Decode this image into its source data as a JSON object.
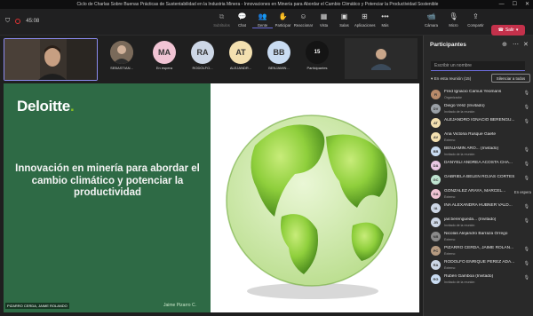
{
  "window": {
    "title": "Ciclo de Charlas Sobre Buenas Prácticas de Sustentabilidad en la Industria Minera - Innovaciones en Minería para Abordar el Cambio Climático y Potenciar la Productividad Sostenible"
  },
  "meeting": {
    "timer": "45:08"
  },
  "toolbar": {
    "items": [
      {
        "label": "Subtítulos",
        "icon": "captions-icon"
      },
      {
        "label": "Chat",
        "icon": "chat-icon"
      },
      {
        "label": "Gente",
        "icon": "people-icon"
      },
      {
        "label": "Participar",
        "icon": "raise-hand-icon"
      },
      {
        "label": "Reaccionar",
        "icon": "react-icon"
      },
      {
        "label": "Vista",
        "icon": "view-icon"
      },
      {
        "label": "Salas",
        "icon": "rooms-icon"
      },
      {
        "label": "Aplicaciones",
        "icon": "apps-icon"
      },
      {
        "label": "Más",
        "icon": "more-icon"
      }
    ],
    "camera": "Cámara",
    "mic": "Micro",
    "share": "Compartir",
    "leave": "Salir"
  },
  "strip": {
    "tiles": [
      {
        "initials": "",
        "name": "SEBASTIAN...",
        "color": "#6b5a4a"
      },
      {
        "initials": "MA",
        "name": "En espera",
        "color": "#f1c4d4"
      },
      {
        "initials": "RA",
        "name": "RODOLFO...",
        "color": "#cdd7e6"
      },
      {
        "initials": "AT",
        "name": "ALEJANDR...",
        "color": "#f3e0b0"
      },
      {
        "initials": "BB",
        "name": "BENJAMIN...",
        "color": "#c9dcf2"
      },
      {
        "initials": "15",
        "name": "Participantes",
        "color": "#141414"
      }
    ]
  },
  "slide": {
    "logo": "Deloitte",
    "logo_dot": ".",
    "title": "Innovación en minería para abordar el cambio climático y potenciar la productividad",
    "presenter": "Jaime Pizarro C.",
    "caption": "PIZARRO CERDA, JAIME ROLANDO"
  },
  "participants": {
    "title": "Participantes",
    "search_placeholder": "Escribir un nombre",
    "section": "En esta reunión (15)",
    "silence_all": "Silenciar a todos",
    "list": [
      {
        "initials": "FI",
        "name": "Fred Ignacio Camus Yeomans",
        "sub": "Organizador",
        "color": "#b88a6a",
        "status": "mic"
      },
      {
        "initials": "DV",
        "name": "Diego Véliz (Invitado)",
        "sub": "Invitado de la reunión",
        "color": "#9aa0a6",
        "status": "mic"
      },
      {
        "initials": "AT",
        "name": "ALEJANDRO IGNACIO BERENGU...",
        "sub": "",
        "color": "#f3e0b0",
        "status": "mic"
      },
      {
        "initials": "AV",
        "name": "Ana Victoria Rusque Gaete",
        "sub": "Externo",
        "color": "#f3e0b0",
        "status": ""
      },
      {
        "initials": "BB",
        "name": "BENJAMIN ARO... (Invitado)",
        "sub": "Invitado de la reunión",
        "color": "#c9dcf2",
        "status": "mic"
      },
      {
        "initials": "DA",
        "name": "DANYELI ANDREA ACOSTA CHA...",
        "sub": "",
        "color": "#e9c7e3",
        "status": "mic"
      },
      {
        "initials": "GC",
        "name": "GABRIELA BELEN ROJAS CORTES",
        "sub": "",
        "color": "#bfe3d0",
        "status": "mic"
      },
      {
        "initials": "GA",
        "name": "GONZALEZ ARAYA, MARCEL...",
        "sub": "Externo",
        "color": "#f1c4d4",
        "status": "En espera"
      },
      {
        "initials": "IA",
        "name": "INA ALEXANDRA HUBNER VALD...",
        "sub": "",
        "color": "#cdd7e6",
        "status": "mic"
      },
      {
        "initials": "JB",
        "name": "jair.berengueda... (Invitado)",
        "sub": "Invitado de la reunión",
        "color": "#cdd7e6",
        "status": "mic"
      },
      {
        "initials": "NB",
        "name": "Nicolas Alejandro Barraza Orrego",
        "sub": "Externo",
        "color": "#8a8a8a",
        "status": ""
      },
      {
        "initials": "PC",
        "name": "PIZARRO CERDA, JAIME ROLAN...",
        "sub": "Externo",
        "color": "#b59a80",
        "status": "mic"
      },
      {
        "initials": "RA",
        "name": "RODOLFO ENRIQUE PEREZ ADA...",
        "sub": "Externo",
        "color": "#cdd7e6",
        "status": "mic"
      },
      {
        "initials": "RG",
        "name": "Rubén Gamboa (Invitado)",
        "sub": "Invitado de la reunión",
        "color": "#c9dcf2",
        "status": "mic"
      }
    ]
  }
}
